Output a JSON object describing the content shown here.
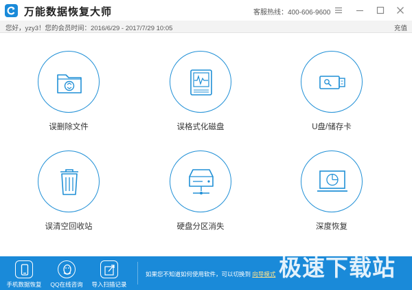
{
  "app": {
    "title": "万能数据恢复大师",
    "hotline": "客服热线：400-606-9600",
    "accent_color": "#1a8ad9"
  },
  "window_controls": [
    "menu-icon",
    "minimize-icon",
    "maximize-icon",
    "close-icon"
  ],
  "infobar": {
    "greeting": "您好，yzy3！您的会员时间：2016/6/29 - 2017/7/29 10:05",
    "recharge": "充值"
  },
  "features": [
    {
      "label": "误删除文件",
      "icon": "deleted-folder-icon"
    },
    {
      "label": "误格式化磁盘",
      "icon": "formatted-disk-icon"
    },
    {
      "label": "U盘/储存卡",
      "icon": "usb-drive-icon"
    },
    {
      "label": "误清空回收站",
      "icon": "recycle-bin-icon"
    },
    {
      "label": "硬盘分区消失",
      "icon": "hard-disk-partition-icon"
    },
    {
      "label": "深度恢复",
      "icon": "deep-scan-monitor-icon"
    }
  ],
  "bottombar": {
    "items": [
      {
        "label": "手机数据恢复",
        "icon": "phone-icon"
      },
      {
        "label": "QQ在线咨询",
        "icon": "qq-penguin-icon"
      },
      {
        "label": "导入扫描记录",
        "icon": "import-icon"
      }
    ],
    "tip": "如果您不知道如何使用软件，可以切换到",
    "guide_link": "向导模式",
    "watermark": "极速下载站"
  }
}
